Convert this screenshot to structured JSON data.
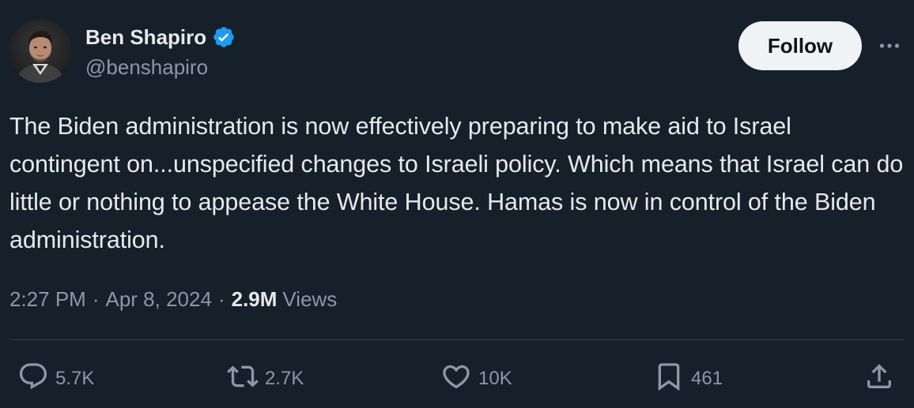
{
  "author": {
    "display_name": "Ben Shapiro",
    "handle": "@benshapiro",
    "verified": true,
    "verified_color": "#1d9bf0"
  },
  "header": {
    "follow_label": "Follow",
    "more_icon": "more-horizontal-icon"
  },
  "tweet": {
    "text": "The Biden administration is now effectively preparing to make aid to Israel contingent on...unspecified changes to Israeli policy. Which means that Israel can do little or nothing to appease the White House. Hamas is now in control of the Biden administration."
  },
  "meta": {
    "time": "2:27 PM",
    "separator": "·",
    "date": "Apr 8, 2024",
    "views_count": "2.9M",
    "views_label": "Views"
  },
  "actions": {
    "reply": {
      "icon": "reply-icon",
      "count": "5.7K"
    },
    "retweet": {
      "icon": "retweet-icon",
      "count": "2.7K"
    },
    "like": {
      "icon": "heart-icon",
      "count": "10K"
    },
    "bookmark": {
      "icon": "bookmark-icon",
      "count": "461"
    },
    "share": {
      "icon": "share-icon"
    }
  },
  "colors": {
    "background": "#15202b",
    "text_primary": "#e7e9ea",
    "text_secondary": "#8b98a5",
    "divider": "#38444d",
    "follow_button_bg": "#eff3f4"
  }
}
